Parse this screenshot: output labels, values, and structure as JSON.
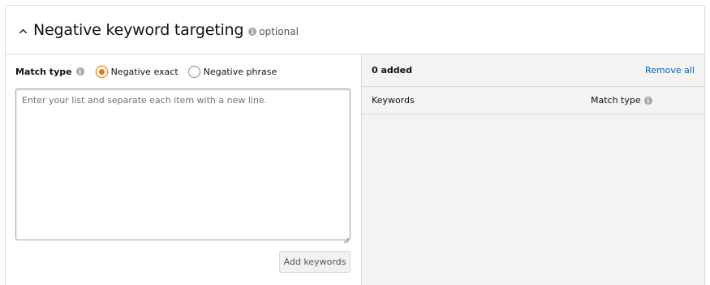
{
  "header": {
    "title": "Negative keyword targeting",
    "optional_label": "optional",
    "chevron_icon": "chevron-up-icon",
    "info_icon": "info-icon"
  },
  "left_panel": {
    "match_type_label": "Match type",
    "radios": [
      {
        "label": "Negative exact",
        "checked": true
      },
      {
        "label": "Negative phrase",
        "checked": false
      }
    ],
    "textarea": {
      "value": "",
      "placeholder": "Enter your list and separate each item with a new line."
    },
    "add_button_label": "Add keywords"
  },
  "right_panel": {
    "added_count": "0 added",
    "remove_all_label": "Remove all",
    "columns": {
      "keywords": "Keywords",
      "match_type": "Match type"
    },
    "rows": []
  },
  "colors": {
    "accent_radio": "#e47911",
    "link": "#0066c0",
    "border": "#d5d9d9",
    "panel_bg": "#f3f3f3"
  }
}
